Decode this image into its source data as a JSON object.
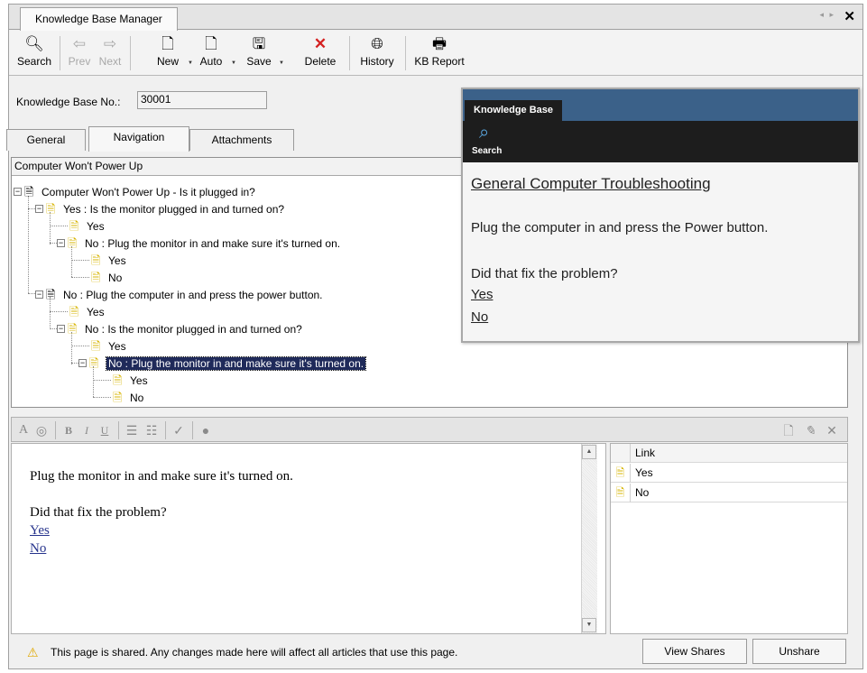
{
  "window": {
    "tab_title": "Knowledge Base Manager",
    "nav_arrows": "◂ ▸",
    "close_glyph": "✕"
  },
  "toolbar": {
    "search": "Search",
    "prev": "Prev",
    "next": "Next",
    "new": "New",
    "auto": "Auto",
    "save": "Save",
    "delete": "Delete",
    "history": "History",
    "kb_report": "KB Report"
  },
  "kb_number": {
    "label": "Knowledge Base No.:",
    "value": "30001"
  },
  "tabs": [
    "General",
    "Navigation",
    "Attachments"
  ],
  "tree": {
    "header": "Computer Won't Power Up",
    "nodes": [
      "Computer Won't Power Up - Is it plugged in?",
      "Yes  :  Is the monitor plugged in and turned on?",
      "Yes",
      "No  :  Plug the monitor in and make sure it's turned on.",
      "Yes",
      "No",
      "No  :  Plug the computer in and press the power button.",
      "Yes",
      "No  :  Is the monitor plugged in and turned on?",
      "Yes",
      "No  :  Plug the monitor in and make sure it's turned on.",
      "Yes",
      "No"
    ]
  },
  "editor": {
    "body": "Plug the monitor in and make sure it's turned on.",
    "question": "Did that fix the problem?",
    "link_yes": "Yes",
    "link_no": "No"
  },
  "link_grid": {
    "header": "Link",
    "rows": [
      "Yes",
      "No"
    ]
  },
  "status": {
    "message": "This page is shared. Any changes made here will affect all articles that use this page.",
    "view_shares": "View Shares",
    "unshare": "Unshare"
  },
  "preview": {
    "tab": "Knowledge Base",
    "search_label": "Search",
    "title": "General Computer Troubleshooting",
    "body": "Plug the computer in and press the Power button.",
    "question": "Did that fix the problem?",
    "link_yes": "Yes",
    "link_no": "No"
  },
  "colors": {
    "selection": "#1f2a5a",
    "link": "#26338c",
    "preview_header": "#3b6189",
    "preview_bar": "#1d1d1d",
    "warning": "#e0a800"
  }
}
